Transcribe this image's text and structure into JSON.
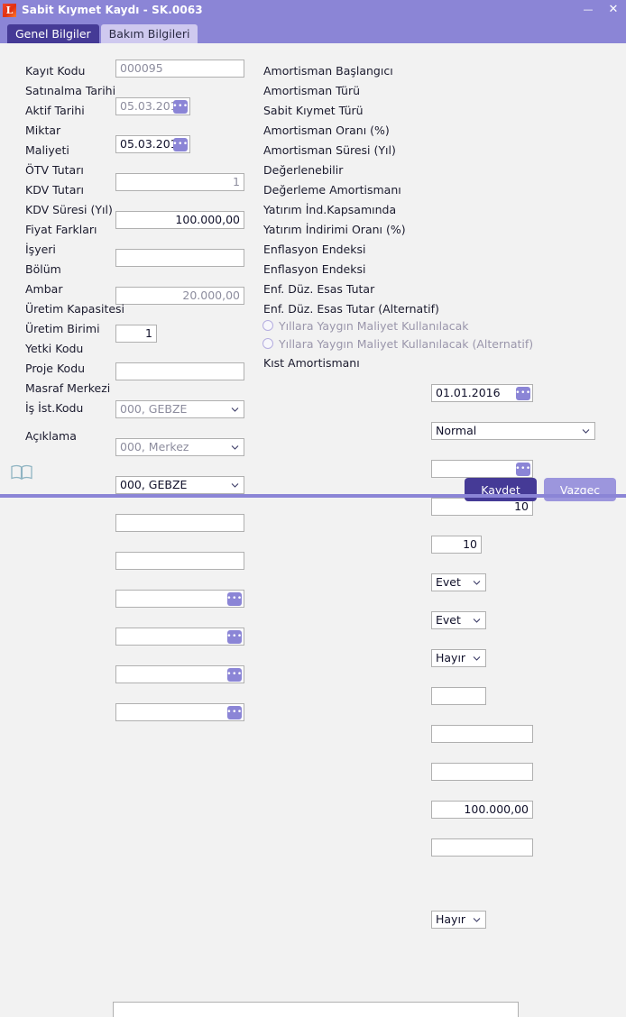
{
  "window": {
    "title": "Sabit Kıymet Kaydı - SK.0063",
    "app_icon": "logo-app-icon",
    "minimize_glyph": "—",
    "close_glyph": "✕"
  },
  "tabs": [
    {
      "label": "Genel Bilgiler",
      "active": true
    },
    {
      "label": "Bakım Bilgileri",
      "active": false
    }
  ],
  "left_column": [
    {
      "label": "Kayıt Kodu",
      "value": "000095",
      "name": "kayit-kodu"
    },
    {
      "label": "Satınalma Tarihi",
      "value": "05.03.2016",
      "name": "satinalma-tarihi"
    },
    {
      "label": "Aktif Tarihi",
      "value": "05.03.2016",
      "name": "aktif-tarihi"
    },
    {
      "label": "Miktar",
      "value": "1",
      "name": "miktar"
    },
    {
      "label": "Maliyeti",
      "value": "100.000,00",
      "name": "maliyeti"
    },
    {
      "label": "ÖTV Tutarı",
      "value": "",
      "name": "otv-tutari"
    },
    {
      "label": "KDV Tutarı",
      "value": "20.000,00",
      "name": "kdv-tutari"
    },
    {
      "label": "KDV Süresi (Yıl)",
      "value": "1",
      "name": "kdv-suresi"
    },
    {
      "label": "Fiyat Farkları",
      "value": "",
      "name": "fiyat-farklari"
    },
    {
      "label": "İşyeri",
      "value": "000, GEBZE",
      "name": "isyeri"
    },
    {
      "label": "Bölüm",
      "value": "000, Merkez",
      "name": "bolum"
    },
    {
      "label": "Ambar",
      "value": "000, GEBZE",
      "name": "ambar"
    },
    {
      "label": "Üretim Kapasitesi",
      "value": "",
      "name": "uretim-kapasitesi"
    },
    {
      "label": "Üretim Birimi",
      "value": "",
      "name": "uretim-birimi"
    },
    {
      "label": "Yetki Kodu",
      "value": "",
      "name": "yetki-kodu"
    },
    {
      "label": "Proje Kodu",
      "value": "",
      "name": "proje-kodu"
    },
    {
      "label": "Masraf Merkezi",
      "value": "",
      "name": "masraf-merkezi"
    },
    {
      "label": "İş İst.Kodu",
      "value": "",
      "name": "is-ist-kodu"
    }
  ],
  "right_column": [
    {
      "label": "Amortisman Başlangıcı",
      "value": "01.01.2016",
      "name": "amortisman-baslangici"
    },
    {
      "label": "Amortisman Türü",
      "value": "Normal",
      "name": "amortisman-turu"
    },
    {
      "label": "Sabit Kıymet Türü",
      "value": "",
      "name": "sabit-kiymet-turu"
    },
    {
      "label": "Amortisman Oranı (%)",
      "value": "10",
      "name": "amortisman-orani"
    },
    {
      "label": "Amortisman Süresi (Yıl)",
      "value": "10",
      "name": "amortisman-suresi"
    },
    {
      "label": "Değerlenebilir",
      "value": "Evet",
      "name": "degerlenebilir"
    },
    {
      "label": "Değerleme Amortismanı",
      "value": "Evet",
      "name": "degerleme-amortismani"
    },
    {
      "label": "Yatırım İnd.Kapsamında",
      "value": "Hayır",
      "name": "yatirim-ind-kapsaminda"
    },
    {
      "label": "Yatırım İndirimi Oranı (%)",
      "value": "",
      "name": "yatirim-indirimi-orani"
    },
    {
      "label": "Enflasyon Endeksi",
      "value": "",
      "name": "enflasyon-endeksi-1"
    },
    {
      "label": "Enflasyon Endeksi",
      "value": "",
      "name": "enflasyon-endeksi-2"
    },
    {
      "label": "Enf. Düz. Esas Tutar",
      "value": "100.000,00",
      "name": "enf-duz-esas-tutar"
    },
    {
      "label": "Enf. Düz. Esas Tutar (Alternatif)",
      "value": "",
      "name": "enf-duz-esas-tutar-alternatif"
    }
  ],
  "checkboxes": [
    {
      "label": "Yıllara Yaygın Maliyet Kullanılacak",
      "checked": false,
      "name": "yillara-yaygin-maliyet"
    },
    {
      "label": "Yıllara Yaygın Maliyet Kullanılacak (Alternatif)",
      "checked": false,
      "name": "yillara-yaygin-maliyet-alternatif"
    }
  ],
  "kist": {
    "label": "Kıst Amortismanı",
    "value": "Hayır"
  },
  "description": {
    "label": "Açıklama",
    "value": "",
    "placeholder": ""
  },
  "footer": {
    "save_label": "Kaydet",
    "save_accel": "K",
    "save_rest": "aydet",
    "cancel_label": "Vazgeç",
    "cancel_accel": "V",
    "cancel_rest": "azgeç",
    "help_icon": "book-icon"
  },
  "colors": {
    "titlebar": "#8b85d6",
    "accent_dark": "#453a96",
    "accent_light": "#9c96dd",
    "tab_inactive": "#cfc9ef",
    "page_bg": "#f2f2f2",
    "field_border": "#b0b0b0",
    "dim_text": "#8d8d9e"
  }
}
